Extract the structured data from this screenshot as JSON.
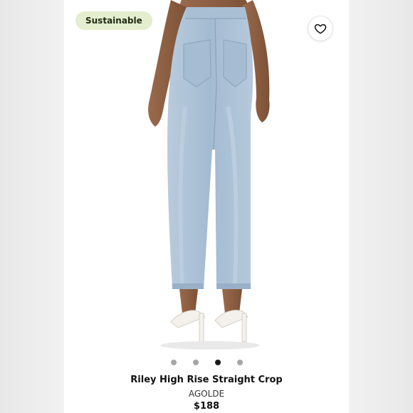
{
  "badge": {
    "label": "Sustainable"
  },
  "favorite": {
    "icon": "heart-icon"
  },
  "gallery": {
    "image_count": 4,
    "active_index": 2
  },
  "product": {
    "title": "Riley High Rise Straight Crop",
    "brand": "AGOLDE",
    "price": "$188"
  },
  "colors": {
    "badge_bg": "#e4edcf",
    "denim": "#a9c0d6",
    "page_bg": "#ffffff"
  }
}
